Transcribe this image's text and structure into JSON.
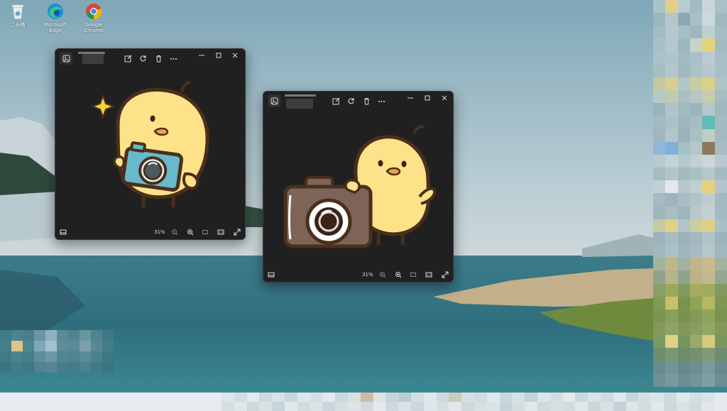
{
  "desktop": {
    "icons": [
      {
        "label": "ごみ箱",
        "name": "recycle-bin"
      },
      {
        "label": "Microsoft Edge",
        "name": "microsoft-edge"
      },
      {
        "label": "Google Chrome",
        "name": "google-chrome"
      }
    ]
  },
  "window1": {
    "zoom": "31%",
    "image_name": "chick-holding-blue-camera"
  },
  "window2": {
    "zoom": "31%",
    "image_name": "chick-with-brown-camera"
  }
}
